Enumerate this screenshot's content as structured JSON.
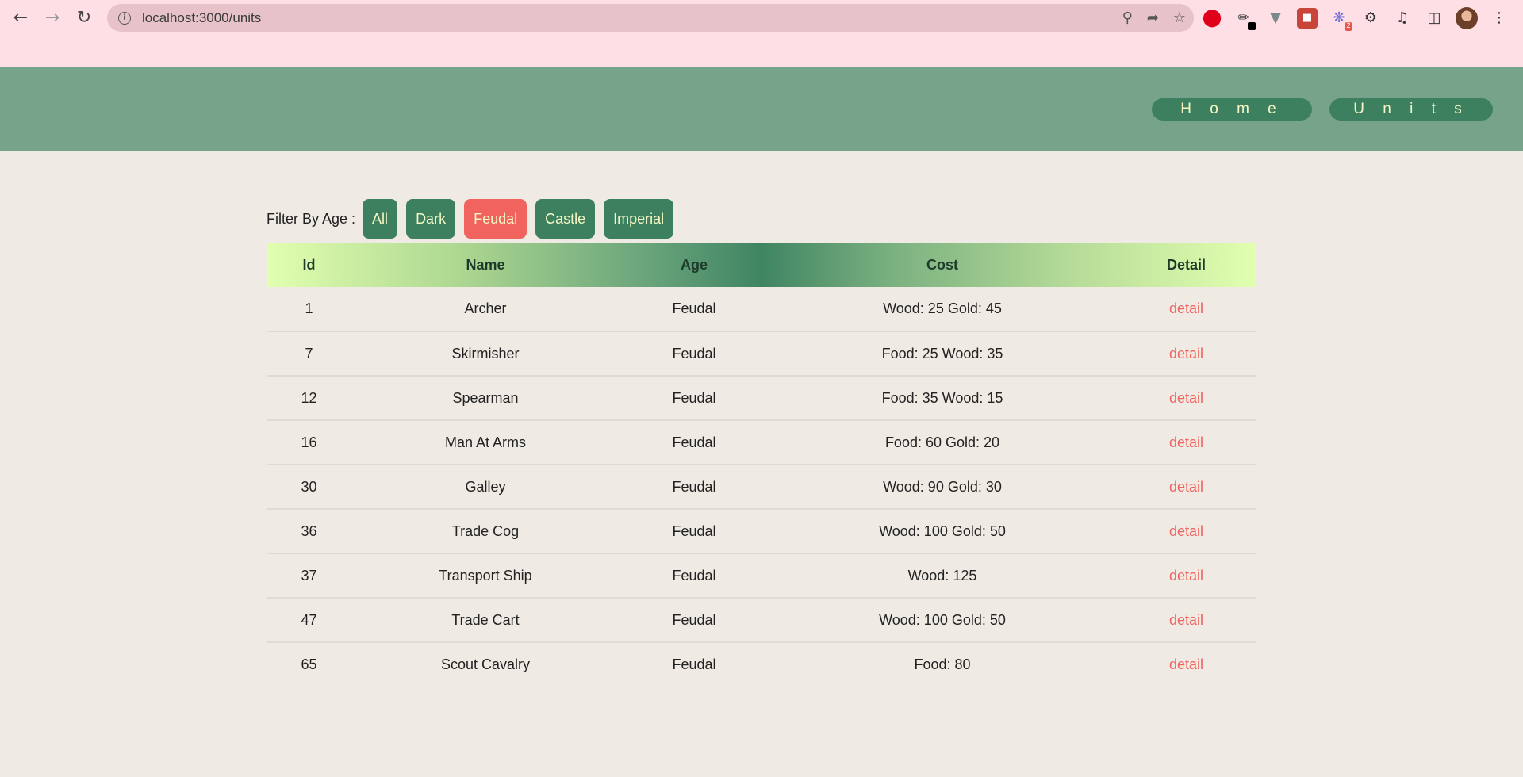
{
  "browser": {
    "url": "localhost:3000/units"
  },
  "nav": {
    "home": "H o m e",
    "units": "U n i t s"
  },
  "filter": {
    "label": "Filter By Age :",
    "buttons": [
      "All",
      "Dark",
      "Feudal",
      "Castle",
      "Imperial"
    ],
    "active": "Feudal"
  },
  "table": {
    "headers": [
      "Id",
      "Name",
      "Age",
      "Cost",
      "Detail"
    ],
    "rows": [
      {
        "id": "1",
        "name": "Archer",
        "age": "Feudal",
        "cost": "Wood: 25 Gold: 45",
        "detail": "detail"
      },
      {
        "id": "7",
        "name": "Skirmisher",
        "age": "Feudal",
        "cost": "Food: 25 Wood: 35",
        "detail": "detail"
      },
      {
        "id": "12",
        "name": "Spearman",
        "age": "Feudal",
        "cost": "Food: 35 Wood: 15",
        "detail": "detail"
      },
      {
        "id": "16",
        "name": "Man At Arms",
        "age": "Feudal",
        "cost": "Food: 60 Gold: 20",
        "detail": "detail"
      },
      {
        "id": "30",
        "name": "Galley",
        "age": "Feudal",
        "cost": "Wood: 90 Gold: 30",
        "detail": "detail"
      },
      {
        "id": "36",
        "name": "Trade Cog",
        "age": "Feudal",
        "cost": "Wood: 100 Gold: 50",
        "detail": "detail"
      },
      {
        "id": "37",
        "name": "Transport Ship",
        "age": "Feudal",
        "cost": "Wood: 125",
        "detail": "detail"
      },
      {
        "id": "47",
        "name": "Trade Cart",
        "age": "Feudal",
        "cost": "Wood: 100 Gold: 50",
        "detail": "detail"
      },
      {
        "id": "65",
        "name": "Scout Cavalry",
        "age": "Feudal",
        "cost": "Food: 80",
        "detail": "detail"
      }
    ]
  },
  "colors": {
    "accent_green": "#3d8060",
    "header_green": "#76a38a",
    "active_red": "#f0635e",
    "browser_pink": "#ffdfe6",
    "page_bg": "#efebe4"
  },
  "icons": {
    "extensions": [
      "opera-adblock-icon",
      "color-picker-icon",
      "vue-devtools-icon",
      "red-extension-icon",
      "sparkle-extension-icon",
      "puzzle-icon",
      "media-icon",
      "side-panel-icon"
    ],
    "extension_badge": "2"
  }
}
